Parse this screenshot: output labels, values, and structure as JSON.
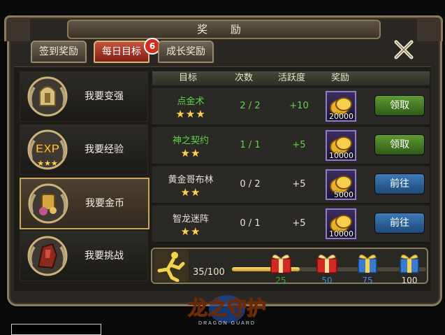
{
  "window": {
    "title": "奖 励"
  },
  "tabs": [
    {
      "label": "签到奖励",
      "active": false
    },
    {
      "label": "每日目标",
      "active": true,
      "badge": "6"
    },
    {
      "label": "成长奖励",
      "active": false
    }
  ],
  "sidebar": {
    "items": [
      {
        "label": "我要变强",
        "icon": "helmet-emblem-icon",
        "active": false
      },
      {
        "label": "我要经验",
        "icon": "exp-emblem-icon",
        "active": false
      },
      {
        "label": "我要金币",
        "icon": "coin-bag-emblem-icon",
        "active": true
      },
      {
        "label": "我要挑战",
        "icon": "warrior-emblem-icon",
        "active": false
      }
    ]
  },
  "table": {
    "headers": [
      "目标",
      "次数",
      "活跃度",
      "奖励"
    ],
    "rows": [
      {
        "name": "点金术",
        "stars": "★★★",
        "count": "2 / 2",
        "activity": "+10",
        "reward": "20000",
        "button": "领取",
        "button_color": "green",
        "complete": true
      },
      {
        "name": "神之契约",
        "stars": "★★",
        "count": "1 / 1",
        "activity": "+5",
        "reward": "10000",
        "button": "领取",
        "button_color": "green",
        "complete": true
      },
      {
        "name": "黄金哥布林",
        "stars": "★★",
        "count": "0 / 2",
        "activity": "+5",
        "reward": "5000",
        "button": "前往",
        "button_color": "blue",
        "complete": false
      },
      {
        "name": "智龙迷阵",
        "stars": "★★",
        "count": "0 / 1",
        "activity": "+5",
        "reward": "10000",
        "button": "前往",
        "button_color": "blue",
        "complete": false
      }
    ]
  },
  "progress": {
    "text": "35/100",
    "value": 35,
    "max": 100,
    "milestones": [
      {
        "label": "25",
        "color": "#3aa93a"
      },
      {
        "label": "50",
        "color": "#3a8fd8"
      },
      {
        "label": "75",
        "color": "#3a8fd8"
      },
      {
        "label": "100",
        "color": "#e8e2c8"
      }
    ]
  },
  "logo": {
    "text": "龙之守护",
    "subtext": "DRAGON GUARD"
  },
  "colors": {
    "accent_gold": "#c9a65e",
    "green_text": "#5fd44a",
    "tab_active": "#b03a28"
  }
}
